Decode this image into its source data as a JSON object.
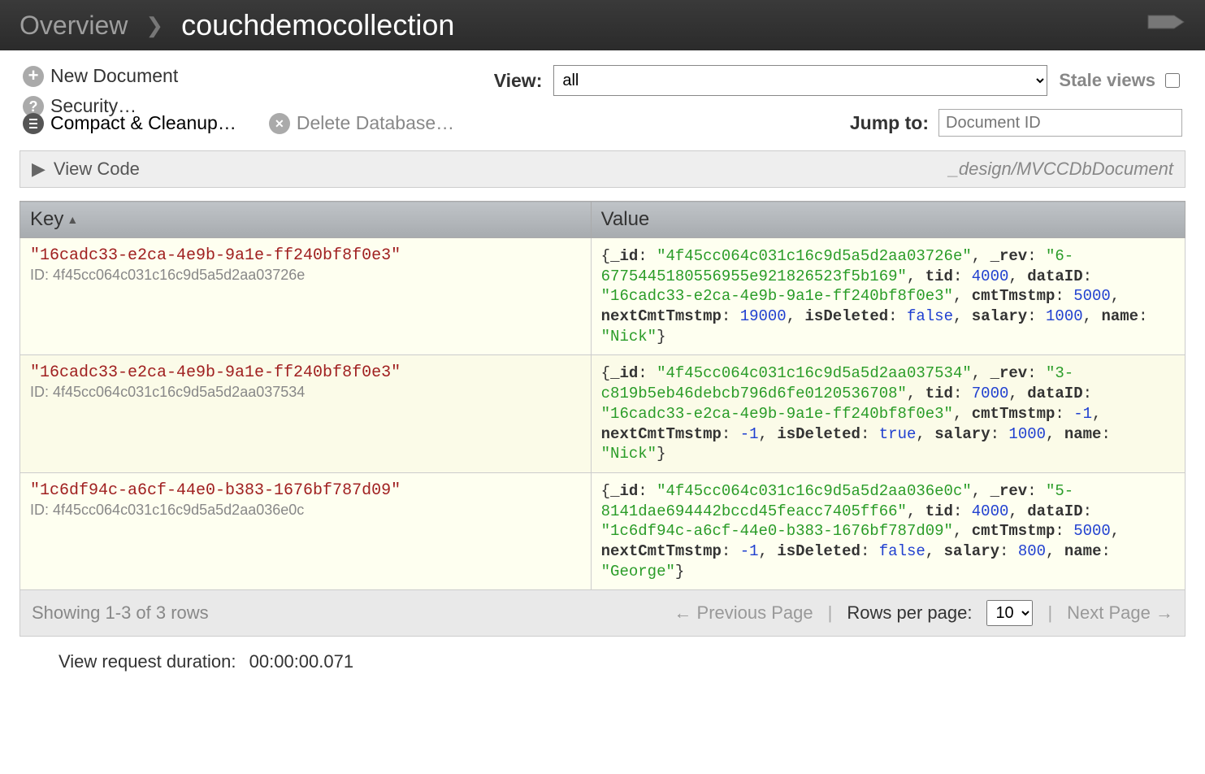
{
  "breadcrumb": {
    "overview": "Overview",
    "dbname": "couchdemocollection"
  },
  "actions": {
    "new_document": "New Document",
    "security": "Security…",
    "compact": "Compact & Cleanup…",
    "delete_db": "Delete Database…"
  },
  "view": {
    "label": "View:",
    "selected": "all",
    "options": [
      "all"
    ],
    "stale_label": "Stale views",
    "stale_checked": false
  },
  "jump": {
    "label": "Jump to:",
    "placeholder": "Document ID"
  },
  "viewcode": {
    "label": "View Code",
    "design": "_design/MVCCDbDocument"
  },
  "columns": {
    "key": "Key",
    "value": "Value"
  },
  "rows": [
    {
      "key": "\"16cadc33-e2ca-4e9b-9a1e-ff240bf8f0e3\"",
      "id_prefix": "ID: ",
      "id": "4f45cc064c031c16c9d5a5d2aa03726e",
      "doc": {
        "_id": "4f45cc064c031c16c9d5a5d2aa03726e",
        "_rev": "6-6775445180556955e921826523f5b169",
        "tid": 4000,
        "dataID": "16cadc33-e2ca-4e9b-9a1e-ff240bf8f0e3",
        "cmtTmstmp": 5000,
        "nextCmtTmstmp": 19000,
        "isDeleted": false,
        "salary": 1000,
        "name": "Nick"
      }
    },
    {
      "key": "\"16cadc33-e2ca-4e9b-9a1e-ff240bf8f0e3\"",
      "id_prefix": "ID: ",
      "id": "4f45cc064c031c16c9d5a5d2aa037534",
      "doc": {
        "_id": "4f45cc064c031c16c9d5a5d2aa037534",
        "_rev": "3-c819b5eb46debcb796d6fe0120536708",
        "tid": 7000,
        "dataID": "16cadc33-e2ca-4e9b-9a1e-ff240bf8f0e3",
        "cmtTmstmp": -1,
        "nextCmtTmstmp": -1,
        "isDeleted": true,
        "salary": 1000,
        "name": "Nick"
      }
    },
    {
      "key": "\"1c6df94c-a6cf-44e0-b383-1676bf787d09\"",
      "id_prefix": "ID: ",
      "id": "4f45cc064c031c16c9d5a5d2aa036e0c",
      "doc": {
        "_id": "4f45cc064c031c16c9d5a5d2aa036e0c",
        "_rev": "5-8141dae694442bccd45feacc7405ff66",
        "tid": 4000,
        "dataID": "1c6df94c-a6cf-44e0-b383-1676bf787d09",
        "cmtTmstmp": 5000,
        "nextCmtTmstmp": -1,
        "isDeleted": false,
        "salary": 800,
        "name": "George"
      }
    }
  ],
  "pager": {
    "showing": "Showing 1-3 of 3 rows",
    "prev": "← Previous Page",
    "rows_per_page_label": "Rows per page:",
    "rows_per_page": "10",
    "next": "Next Page →"
  },
  "duration": {
    "label": "View request duration:",
    "value": "00:00:00.071"
  }
}
